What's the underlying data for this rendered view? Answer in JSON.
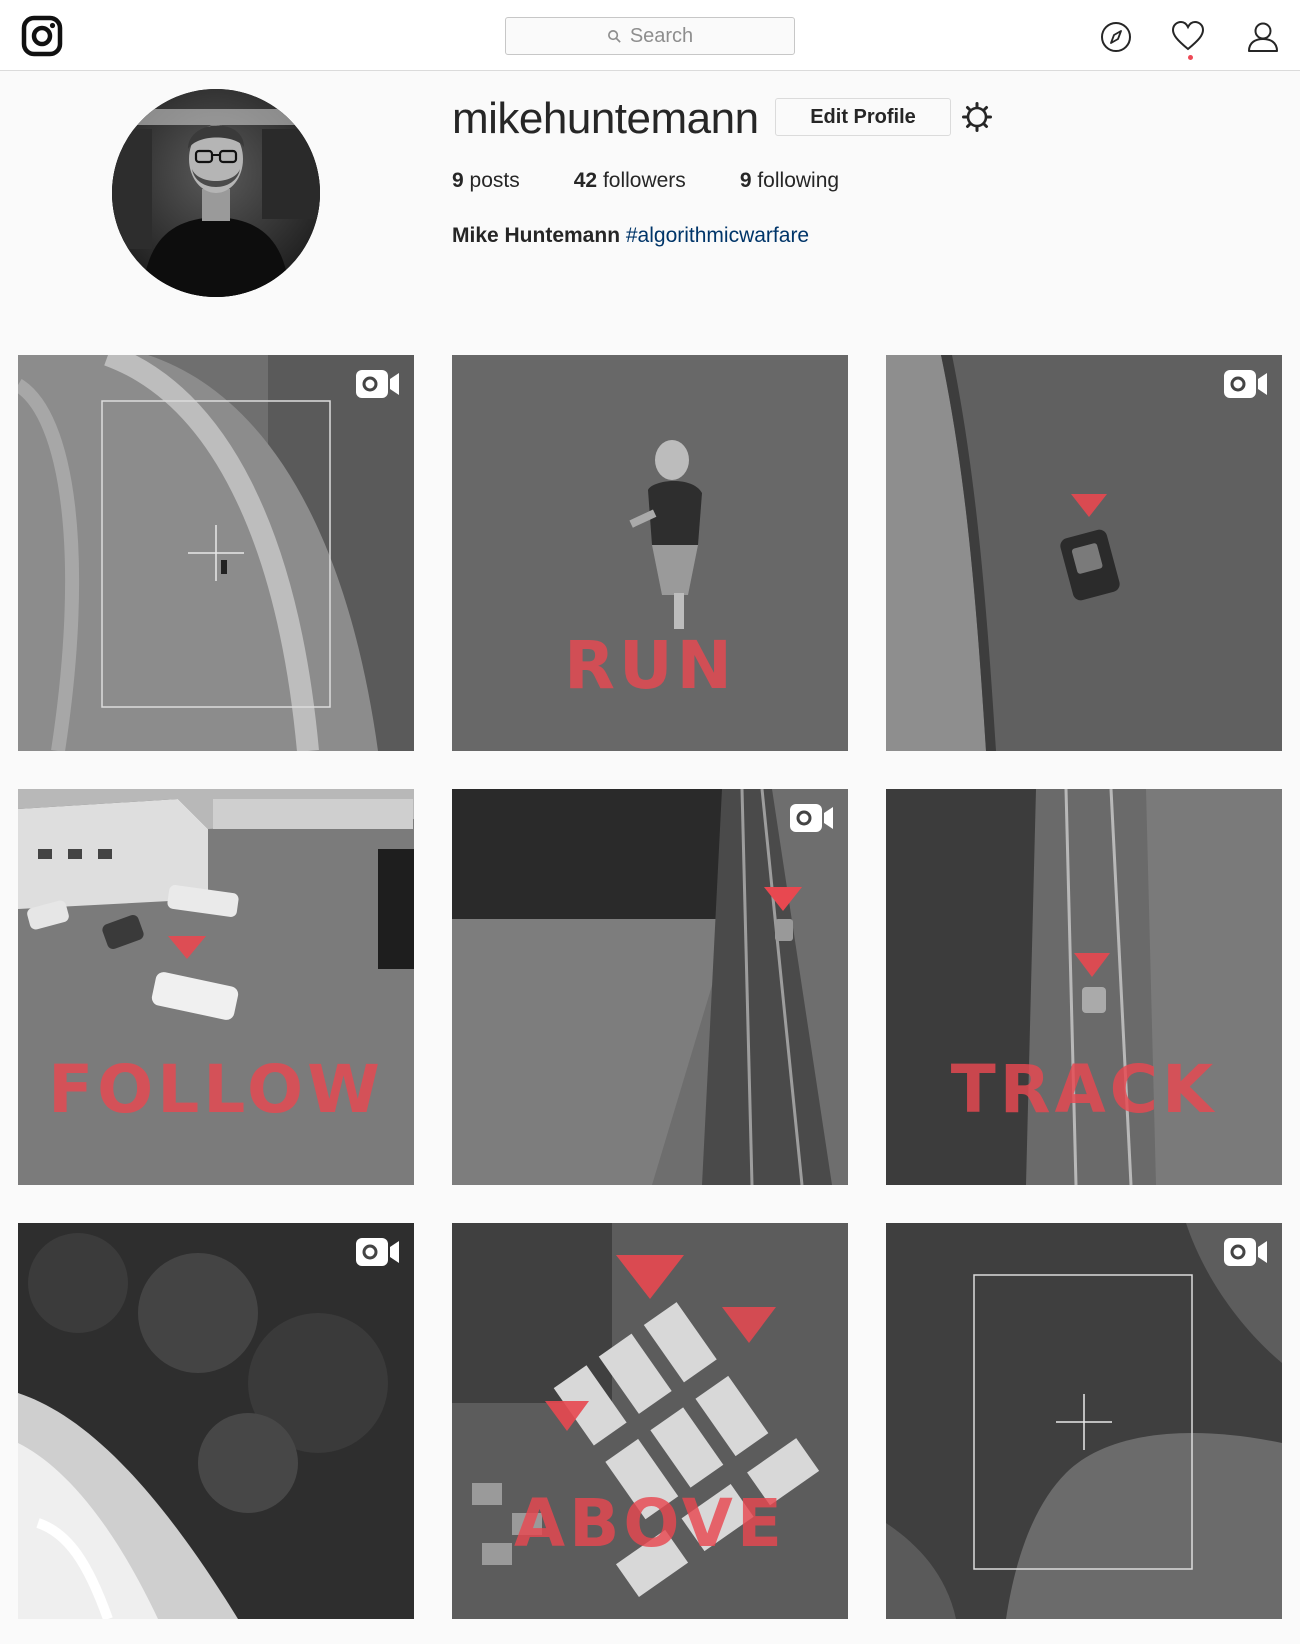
{
  "nav": {
    "logo_icon": "instagram-logo-icon",
    "search_placeholder": "Search",
    "icons": [
      "compass-icon",
      "heart-icon",
      "user-icon"
    ],
    "notification_color": "#ed4956"
  },
  "profile": {
    "username": "mikehuntemann",
    "edit_label": "Edit Profile",
    "stats": {
      "posts_count": "9",
      "posts_label": "posts",
      "followers_count": "42",
      "followers_label": "followers",
      "following_count": "9",
      "following_label": "following"
    },
    "full_name": "Mike Huntemann",
    "hashtag": "#algorithmicwarfare"
  },
  "posts": [
    {
      "overlay": "",
      "is_video": true
    },
    {
      "overlay": "RUN",
      "is_video": false
    },
    {
      "overlay": "",
      "is_video": true
    },
    {
      "overlay": "FOLLOW",
      "is_video": false
    },
    {
      "overlay": "",
      "is_video": true
    },
    {
      "overlay": "TRACK",
      "is_video": false
    },
    {
      "overlay": "",
      "is_video": true
    },
    {
      "overlay": "ABOVE",
      "is_video": false
    },
    {
      "overlay": "",
      "is_video": true
    }
  ],
  "colors": {
    "overlay_red": "#e84850",
    "link_blue": "#003569",
    "border": "#dbdbdb"
  }
}
